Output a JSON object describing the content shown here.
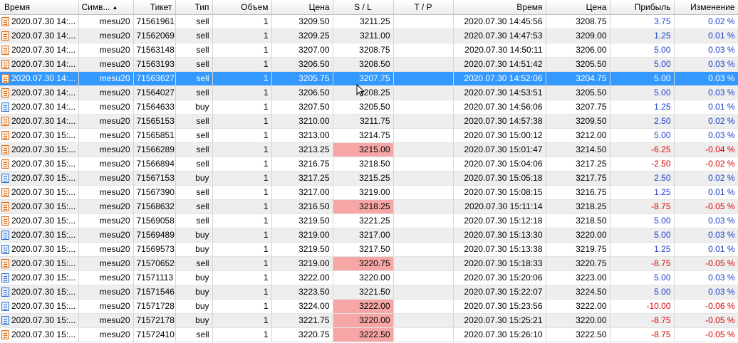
{
  "headers": {
    "time_open": "Время",
    "symbol": "Симв...",
    "ticket": "Тикет",
    "type": "Тип",
    "volume": "Объем",
    "price_open": "Цена",
    "sl": "S / L",
    "tp": "T / P",
    "time_close": "Время",
    "price_close": "Цена",
    "profit": "Прибыль",
    "change": "Изменение"
  },
  "sort_indicator": "▲",
  "selected_row": 4,
  "rows": [
    {
      "time_open": "2020.07.30 14:...",
      "symbol": "mesu20",
      "ticket": "71561961",
      "type": "sell",
      "volume": "1",
      "price_open": "3209.50",
      "sl": "3211.25",
      "tp": "",
      "time_close": "2020.07.30 14:45:56",
      "price_close": "3208.75",
      "profit": "3.75",
      "change": "0.02 %",
      "sl_hit": false,
      "negative": false
    },
    {
      "time_open": "2020.07.30 14:...",
      "symbol": "mesu20",
      "ticket": "71562069",
      "type": "sell",
      "volume": "1",
      "price_open": "3209.25",
      "sl": "3211.00",
      "tp": "",
      "time_close": "2020.07.30 14:47:53",
      "price_close": "3209.00",
      "profit": "1.25",
      "change": "0.01 %",
      "sl_hit": false,
      "negative": false
    },
    {
      "time_open": "2020.07.30 14:...",
      "symbol": "mesu20",
      "ticket": "71563148",
      "type": "sell",
      "volume": "1",
      "price_open": "3207.00",
      "sl": "3208.75",
      "tp": "",
      "time_close": "2020.07.30 14:50:11",
      "price_close": "3206.00",
      "profit": "5.00",
      "change": "0.03 %",
      "sl_hit": false,
      "negative": false
    },
    {
      "time_open": "2020.07.30 14:...",
      "symbol": "mesu20",
      "ticket": "71563193",
      "type": "sell",
      "volume": "1",
      "price_open": "3206.50",
      "sl": "3208.50",
      "tp": "",
      "time_close": "2020.07.30 14:51:42",
      "price_close": "3205.50",
      "profit": "5.00",
      "change": "0.03 %",
      "sl_hit": false,
      "negative": false
    },
    {
      "time_open": "2020.07.30 14:...",
      "symbol": "mesu20",
      "ticket": "71563627",
      "type": "sell",
      "volume": "1",
      "price_open": "3205.75",
      "sl": "3207.75",
      "tp": "",
      "time_close": "2020.07.30 14:52:06",
      "price_close": "3204.75",
      "profit": "5.00",
      "change": "0.03 %",
      "sl_hit": false,
      "negative": false
    },
    {
      "time_open": "2020.07.30 14:...",
      "symbol": "mesu20",
      "ticket": "71564027",
      "type": "sell",
      "volume": "1",
      "price_open": "3206.50",
      "sl": "3208.25",
      "tp": "",
      "time_close": "2020.07.30 14:53:51",
      "price_close": "3205.50",
      "profit": "5.00",
      "change": "0.03 %",
      "sl_hit": false,
      "negative": false
    },
    {
      "time_open": "2020.07.30 14:...",
      "symbol": "mesu20",
      "ticket": "71564633",
      "type": "buy",
      "volume": "1",
      "price_open": "3207.50",
      "sl": "3205.50",
      "tp": "",
      "time_close": "2020.07.30 14:56:06",
      "price_close": "3207.75",
      "profit": "1.25",
      "change": "0.01 %",
      "sl_hit": false,
      "negative": false
    },
    {
      "time_open": "2020.07.30 14:...",
      "symbol": "mesu20",
      "ticket": "71565153",
      "type": "sell",
      "volume": "1",
      "price_open": "3210.00",
      "sl": "3211.75",
      "tp": "",
      "time_close": "2020.07.30 14:57:38",
      "price_close": "3209.50",
      "profit": "2.50",
      "change": "0.02 %",
      "sl_hit": false,
      "negative": false
    },
    {
      "time_open": "2020.07.30 15:...",
      "symbol": "mesu20",
      "ticket": "71565851",
      "type": "sell",
      "volume": "1",
      "price_open": "3213.00",
      "sl": "3214.75",
      "tp": "",
      "time_close": "2020.07.30 15:00:12",
      "price_close": "3212.00",
      "profit": "5.00",
      "change": "0.03 %",
      "sl_hit": false,
      "negative": false
    },
    {
      "time_open": "2020.07.30 15:...",
      "symbol": "mesu20",
      "ticket": "71566289",
      "type": "sell",
      "volume": "1",
      "price_open": "3213.25",
      "sl": "3215.00",
      "tp": "",
      "time_close": "2020.07.30 15:01:47",
      "price_close": "3214.50",
      "profit": "-6.25",
      "change": "-0.04 %",
      "sl_hit": true,
      "negative": true
    },
    {
      "time_open": "2020.07.30 15:...",
      "symbol": "mesu20",
      "ticket": "71566894",
      "type": "sell",
      "volume": "1",
      "price_open": "3216.75",
      "sl": "3218.50",
      "tp": "",
      "time_close": "2020.07.30 15:04:06",
      "price_close": "3217.25",
      "profit": "-2.50",
      "change": "-0.02 %",
      "sl_hit": false,
      "negative": true
    },
    {
      "time_open": "2020.07.30 15:...",
      "symbol": "mesu20",
      "ticket": "71567153",
      "type": "buy",
      "volume": "1",
      "price_open": "3217.25",
      "sl": "3215.25",
      "tp": "",
      "time_close": "2020.07.30 15:05:18",
      "price_close": "3217.75",
      "profit": "2.50",
      "change": "0.02 %",
      "sl_hit": false,
      "negative": false
    },
    {
      "time_open": "2020.07.30 15:...",
      "symbol": "mesu20",
      "ticket": "71567390",
      "type": "sell",
      "volume": "1",
      "price_open": "3217.00",
      "sl": "3219.00",
      "tp": "",
      "time_close": "2020.07.30 15:08:15",
      "price_close": "3216.75",
      "profit": "1.25",
      "change": "0.01 %",
      "sl_hit": false,
      "negative": false
    },
    {
      "time_open": "2020.07.30 15:...",
      "symbol": "mesu20",
      "ticket": "71568632",
      "type": "sell",
      "volume": "1",
      "price_open": "3216.50",
      "sl": "3218.25",
      "tp": "",
      "time_close": "2020.07.30 15:11:14",
      "price_close": "3218.25",
      "profit": "-8.75",
      "change": "-0.05 %",
      "sl_hit": true,
      "negative": true
    },
    {
      "time_open": "2020.07.30 15:...",
      "symbol": "mesu20",
      "ticket": "71569058",
      "type": "sell",
      "volume": "1",
      "price_open": "3219.50",
      "sl": "3221.25",
      "tp": "",
      "time_close": "2020.07.30 15:12:18",
      "price_close": "3218.50",
      "profit": "5.00",
      "change": "0.03 %",
      "sl_hit": false,
      "negative": false
    },
    {
      "time_open": "2020.07.30 15:...",
      "symbol": "mesu20",
      "ticket": "71569489",
      "type": "buy",
      "volume": "1",
      "price_open": "3219.00",
      "sl": "3217.00",
      "tp": "",
      "time_close": "2020.07.30 15:13:30",
      "price_close": "3220.00",
      "profit": "5.00",
      "change": "0.03 %",
      "sl_hit": false,
      "negative": false
    },
    {
      "time_open": "2020.07.30 15:...",
      "symbol": "mesu20",
      "ticket": "71569573",
      "type": "buy",
      "volume": "1",
      "price_open": "3219.50",
      "sl": "3217.50",
      "tp": "",
      "time_close": "2020.07.30 15:13:38",
      "price_close": "3219.75",
      "profit": "1.25",
      "change": "0.01 %",
      "sl_hit": false,
      "negative": false
    },
    {
      "time_open": "2020.07.30 15:...",
      "symbol": "mesu20",
      "ticket": "71570652",
      "type": "sell",
      "volume": "1",
      "price_open": "3219.00",
      "sl": "3220.75",
      "tp": "",
      "time_close": "2020.07.30 15:18:33",
      "price_close": "3220.75",
      "profit": "-8.75",
      "change": "-0.05 %",
      "sl_hit": true,
      "negative": true
    },
    {
      "time_open": "2020.07.30 15:...",
      "symbol": "mesu20",
      "ticket": "71571113",
      "type": "buy",
      "volume": "1",
      "price_open": "3222.00",
      "sl": "3220.00",
      "tp": "",
      "time_close": "2020.07.30 15:20:06",
      "price_close": "3223.00",
      "profit": "5.00",
      "change": "0.03 %",
      "sl_hit": false,
      "negative": false
    },
    {
      "time_open": "2020.07.30 15:...",
      "symbol": "mesu20",
      "ticket": "71571546",
      "type": "buy",
      "volume": "1",
      "price_open": "3223.50",
      "sl": "3221.50",
      "tp": "",
      "time_close": "2020.07.30 15:22:07",
      "price_close": "3224.50",
      "profit": "5.00",
      "change": "0.03 %",
      "sl_hit": false,
      "negative": false
    },
    {
      "time_open": "2020.07.30 15:...",
      "symbol": "mesu20",
      "ticket": "71571728",
      "type": "buy",
      "volume": "1",
      "price_open": "3224.00",
      "sl": "3222.00",
      "tp": "",
      "time_close": "2020.07.30 15:23:56",
      "price_close": "3222.00",
      "profit": "-10.00",
      "change": "-0.06 %",
      "sl_hit": true,
      "negative": true
    },
    {
      "time_open": "2020.07.30 15:...",
      "symbol": "mesu20",
      "ticket": "71572178",
      "type": "buy",
      "volume": "1",
      "price_open": "3221.75",
      "sl": "3220.00",
      "tp": "",
      "time_close": "2020.07.30 15:25:21",
      "price_close": "3220.00",
      "profit": "-8.75",
      "change": "-0.05 %",
      "sl_hit": true,
      "negative": true
    },
    {
      "time_open": "2020.07.30 15:...",
      "symbol": "mesu20",
      "ticket": "71572410",
      "type": "sell",
      "volume": "1",
      "price_open": "3220.75",
      "sl": "3222.50",
      "tp": "",
      "time_close": "2020.07.30 15:26:10",
      "price_close": "3222.50",
      "profit": "-8.75",
      "change": "-0.05 %",
      "sl_hit": true,
      "negative": true
    }
  ]
}
